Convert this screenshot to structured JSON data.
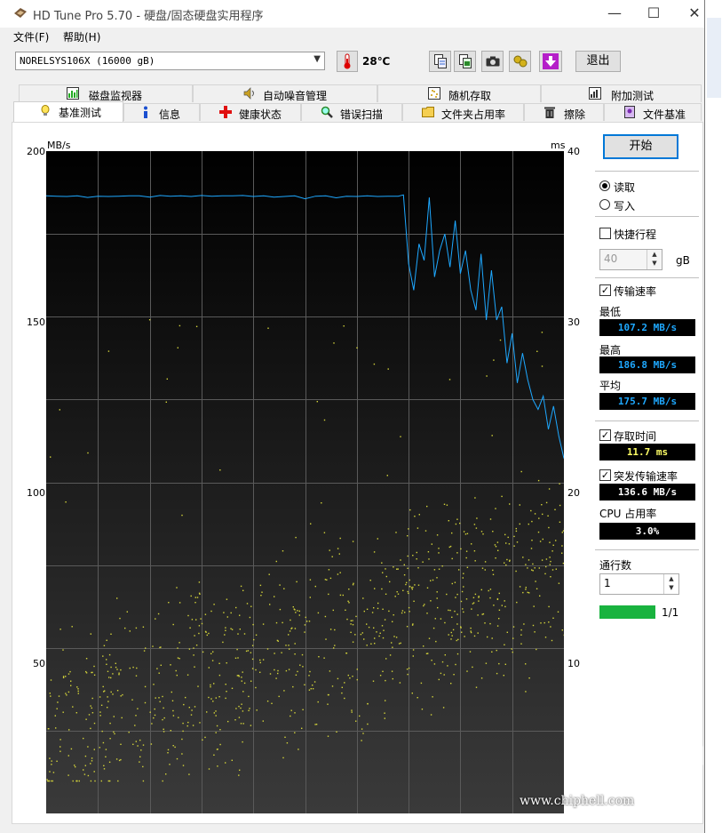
{
  "window": {
    "title": "HD Tune Pro 5.70 - 硬盘/固态硬盘实用程序",
    "controls": {
      "minimize": "—",
      "maximize": "☐",
      "close": "✕"
    }
  },
  "menu": {
    "file": "文件(F)",
    "help": "帮助(H)"
  },
  "toolbar": {
    "drive": "NORELSYS106X (16000 gB)",
    "temperature": "28℃",
    "exit_label": "退出",
    "icons": [
      "copy-text-icon",
      "copy-screenshot-icon",
      "camera-icon",
      "options-icon",
      "download-icon"
    ]
  },
  "tabs": {
    "row1": [
      {
        "label": "磁盘监视器",
        "icon": "disk-monitor-icon"
      },
      {
        "label": "自动噪音管理",
        "icon": "speaker-icon"
      },
      {
        "label": "随机存取",
        "icon": "random-access-icon"
      },
      {
        "label": "附加测试",
        "icon": "extra-tests-icon"
      }
    ],
    "row2": [
      {
        "label": "基准测试",
        "icon": "lightbulb-icon",
        "active": true
      },
      {
        "label": "信息",
        "icon": "info-icon"
      },
      {
        "label": "健康状态",
        "icon": "health-cross-icon"
      },
      {
        "label": "错误扫描",
        "icon": "magnifier-icon"
      },
      {
        "label": "文件夹占用率",
        "icon": "folder-icon"
      },
      {
        "label": "擦除",
        "icon": "trash-icon"
      },
      {
        "label": "文件基准",
        "icon": "file-benchmark-icon"
      }
    ]
  },
  "chart_data": {
    "type": "line",
    "y_left_label": "MB/s",
    "y_right_label": "ms",
    "y_left_ticks": [
      200,
      150,
      100,
      50
    ],
    "y_right_ticks": [
      40,
      30,
      20,
      10
    ],
    "ylim_left": [
      0,
      200
    ],
    "ylim_right": [
      0,
      40
    ],
    "grid": true,
    "series": [
      {
        "name": "传输速率",
        "color": "#1ea8ff",
        "x": [
          0,
          2,
          4,
          6,
          8,
          10,
          12,
          14,
          16,
          18,
          20,
          22,
          24,
          26,
          28,
          30,
          32,
          34,
          36,
          38,
          40,
          42,
          44,
          46,
          48,
          50,
          52,
          54,
          56,
          58,
          60,
          62,
          64,
          66,
          68,
          69,
          70,
          71,
          72,
          73,
          74,
          75,
          76,
          77,
          78,
          79,
          80,
          81,
          82,
          83,
          84,
          85,
          86,
          87,
          88,
          89,
          90,
          91,
          92,
          93,
          94,
          95,
          96,
          97,
          98,
          99,
          100
        ],
        "values": [
          186.5,
          186.4,
          186.3,
          186.5,
          186.0,
          186.4,
          186.3,
          186.4,
          186.5,
          186.5,
          186.1,
          186.6,
          186.4,
          186.5,
          186.3,
          186.6,
          186.4,
          186.5,
          186.5,
          186.6,
          186.3,
          186.5,
          186.1,
          186.3,
          186.5,
          185.6,
          186.4,
          186.5,
          185.9,
          186.4,
          186.3,
          186.5,
          186.3,
          186.4,
          186.4,
          186.8,
          166.0,
          158.0,
          172.0,
          167.0,
          186.0,
          162.0,
          170.0,
          175.0,
          165.0,
          179.0,
          163.0,
          170.0,
          158.0,
          152.0,
          169.0,
          149.0,
          164.0,
          149.0,
          153.0,
          136.0,
          145.0,
          130.0,
          139.0,
          131.0,
          125.0,
          122.0,
          126.0,
          116.0,
          123.0,
          114.0,
          107.2
        ]
      },
      {
        "name": "存取时间",
        "color": "#d4d43a",
        "type": "scatter",
        "axis": "right",
        "description_values_ms": [
          2,
          20
        ],
        "average": 11.7
      }
    ]
  },
  "panel": {
    "start_label": "开始",
    "read_label": "读取",
    "write_label": "写入",
    "short_stroke_label": "快捷行程",
    "short_stroke_value": "40",
    "short_stroke_unit": "gB",
    "transfer_rate_label": "传输速率",
    "min_label": "最低",
    "min_value": "107.2 MB/s",
    "max_label": "最高",
    "max_value": "186.8 MB/s",
    "avg_label": "平均",
    "avg_value": "175.7 MB/s",
    "access_time_label": "存取时间",
    "access_time_value": "11.7 ms",
    "burst_rate_label": "突发传输速率",
    "burst_rate_value": "136.6 MB/s",
    "cpu_label": "CPU 占用率",
    "cpu_value": "3.0%",
    "passes_label": "通行数",
    "passes_value": "1",
    "progress_text": "1/1",
    "progress": 1.0,
    "colors": {
      "readout_blue": "#1ea8ff",
      "readout_yellow": "#ffff66",
      "readout_white": "#ffffff",
      "progress_green": "#19b33f"
    }
  },
  "watermark": {
    "url": "www.chiphell.com",
    "logo": "chip hell"
  }
}
